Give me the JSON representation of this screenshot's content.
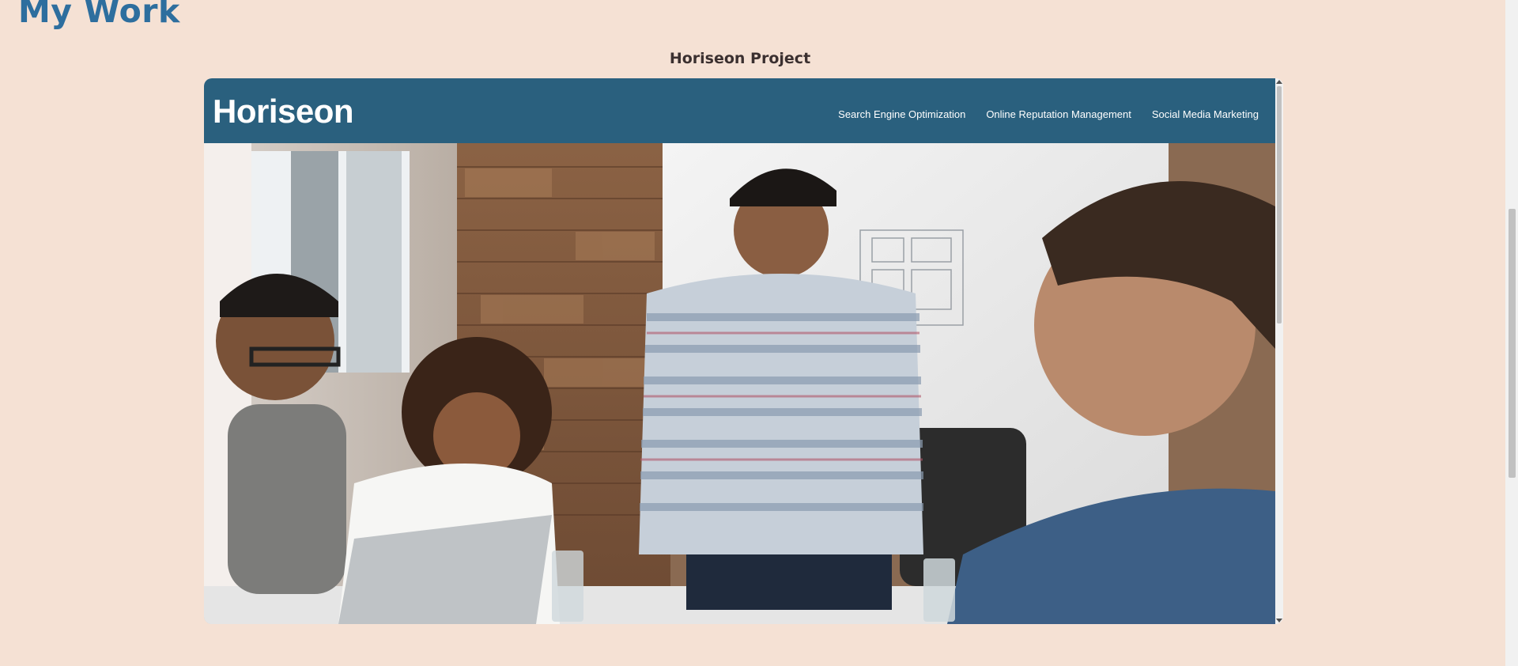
{
  "page": {
    "title": "My Work"
  },
  "project": {
    "caption": "Horiseon Project"
  },
  "embedded_site": {
    "logo": "Horiseon",
    "nav": [
      {
        "label": "Search Engine Optimization"
      },
      {
        "label": "Online Reputation Management"
      },
      {
        "label": "Social Media Marketing"
      }
    ]
  },
  "colors": {
    "page_background": "#f5e1d4",
    "heading_blue": "#2d6e9e",
    "site_header": "#2a607e"
  }
}
